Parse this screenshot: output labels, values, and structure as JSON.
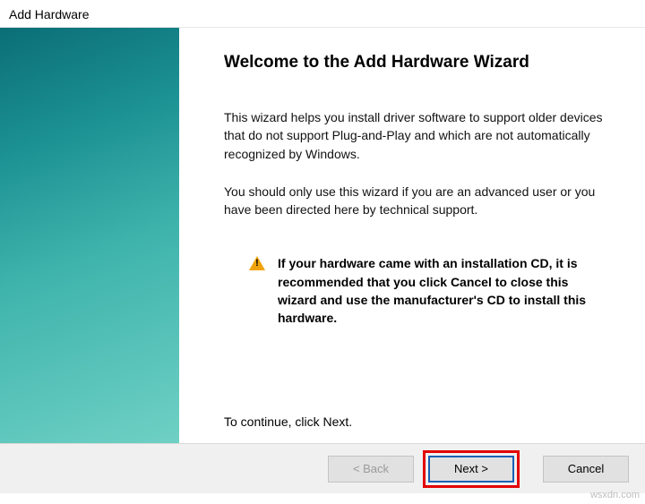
{
  "window": {
    "title": "Add Hardware"
  },
  "main": {
    "heading": "Welcome to the Add Hardware Wizard",
    "para1": "This wizard helps you install driver software to support older devices that do not support Plug-and-Play and which are not automatically recognized by Windows.",
    "para2": "You should only use this wizard if you are an advanced user or you have been directed here by technical support.",
    "notice": "If your hardware came with an installation CD, it is recommended that you click Cancel to close this wizard and use the manufacturer's CD to install this hardware.",
    "continue": "To continue, click Next."
  },
  "buttons": {
    "back": "< Back",
    "next": "Next >",
    "cancel": "Cancel"
  },
  "watermark": "wsxdn.com"
}
